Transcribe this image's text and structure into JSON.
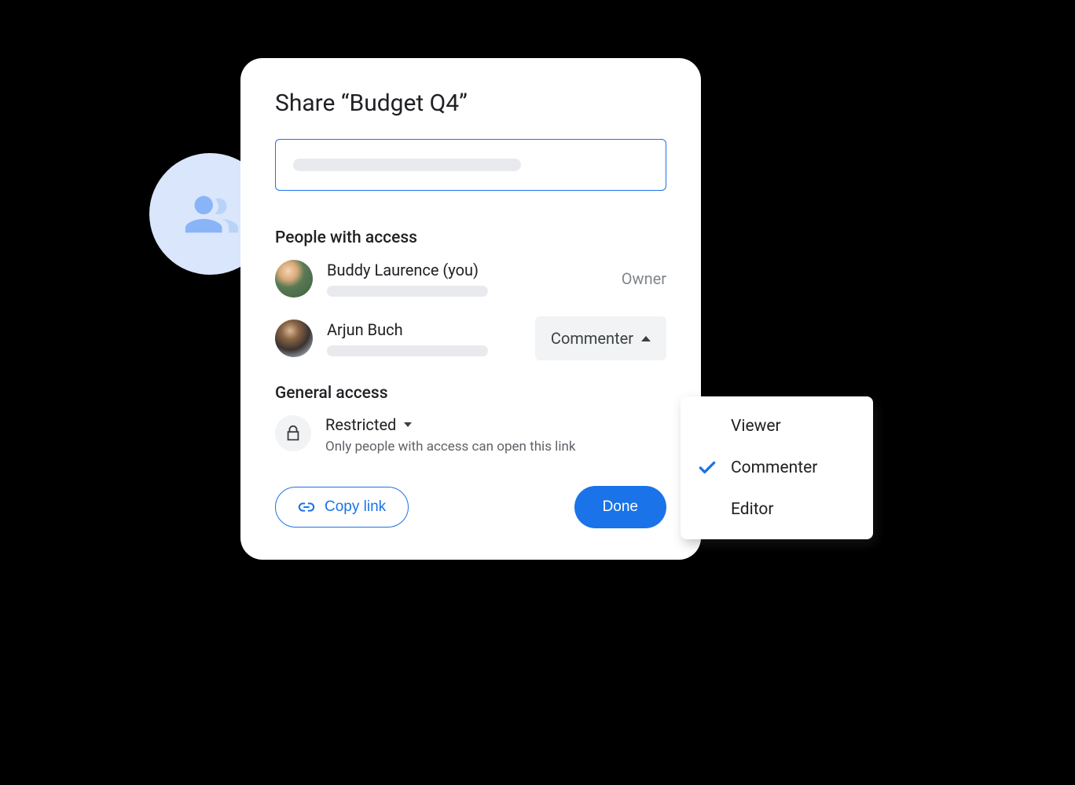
{
  "dialog": {
    "title": "Share “Budget Q4”",
    "people_section_header": "People with access",
    "people": [
      {
        "name": "Buddy Laurence (you)",
        "role": "Owner"
      },
      {
        "name": "Arjun Buch",
        "role": "Commenter"
      }
    ],
    "general_section_header": "General access",
    "general": {
      "mode": "Restricted",
      "description": "Only people with access can open this link"
    },
    "copy_link_label": "Copy link",
    "done_label": "Done"
  },
  "role_menu": {
    "options": [
      "Viewer",
      "Commenter",
      "Editor"
    ],
    "selected": "Commenter"
  },
  "colors": {
    "primary": "#1a73e8",
    "badge_bg": "#d9e6fb"
  }
}
